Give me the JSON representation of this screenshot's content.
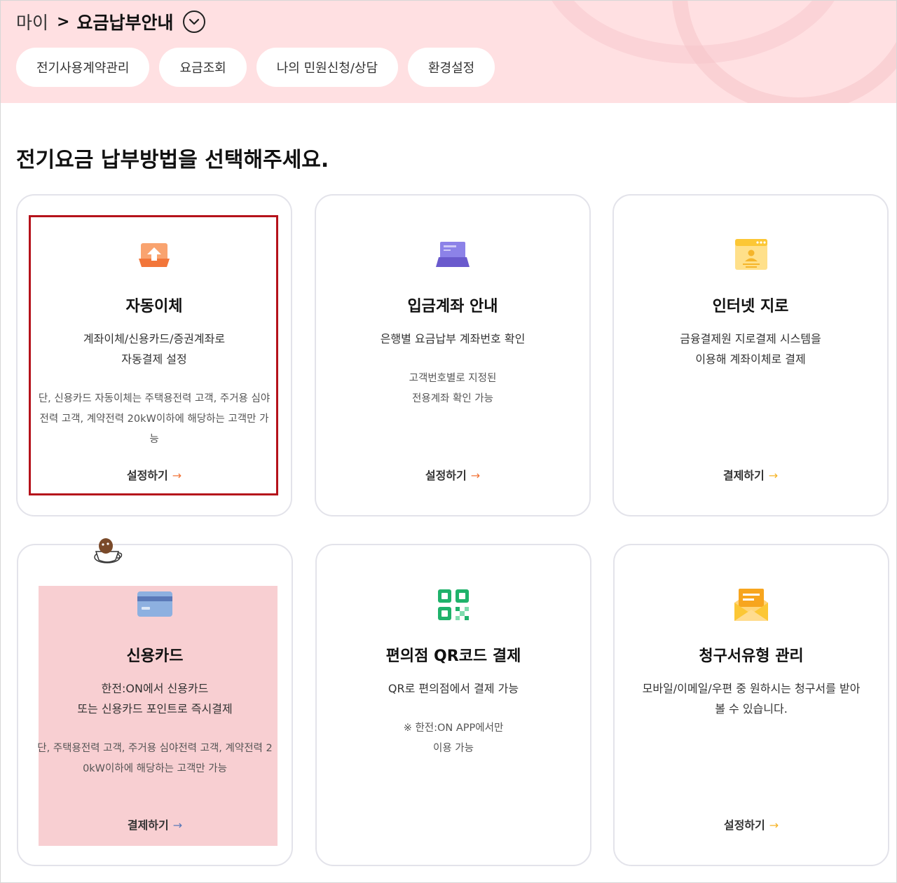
{
  "breadcrumb": {
    "home": "마이",
    "separator": ">",
    "current": "요금납부안내"
  },
  "tabs": [
    {
      "label": "전기사용계약관리"
    },
    {
      "label": "요금조회"
    },
    {
      "label": "나의 민원신청/상담"
    },
    {
      "label": "환경설정"
    }
  ],
  "page_title": "전기요금 납부방법을 선택해주세요.",
  "cards": [
    {
      "title": "자동이체",
      "desc": [
        "계좌이체/신용카드/증권계좌로",
        "자동결제 설정"
      ],
      "note": [
        "단, 신용카드 자동이체는 주택용전력 고객, 주거용 심야",
        "전력 고객, 계약전력 20kW이하에 해당하는 고객만 가",
        "능"
      ],
      "action": "설정하기",
      "icon": "upload-icon"
    },
    {
      "title": "입금계좌 안내",
      "desc": [
        "은행별 요금납부 계좌번호 확인"
      ],
      "note": [
        "고객번호별로 지정된",
        "전용계좌 확인 가능"
      ],
      "action": "설정하기",
      "icon": "laptop-icon"
    },
    {
      "title": "인터넷 지로",
      "desc": [
        "금융결제원 지로결제 시스템을",
        "이용해 계좌이체로 결제"
      ],
      "note": [],
      "action": "결제하기",
      "icon": "web-profile-icon"
    },
    {
      "title": "신용카드",
      "desc": [
        "한전:ON에서 신용카드",
        "또는 신용카드 포인트로 즉시결제"
      ],
      "note": [
        "단, 주택용전력 고객, 주거용 심야전력 고객, 계약전력 2",
        "0kW이하에 해당하는 고객만 가능"
      ],
      "action": "결제하기",
      "icon": "credit-card-icon"
    },
    {
      "title": "편의점 QR코드 결제",
      "desc": [
        "QR로 편의점에서 결제 가능"
      ],
      "note": [
        "※ 한전:ON APP에서만",
        "이용 가능"
      ],
      "action": "",
      "icon": "qr-code-icon"
    },
    {
      "title": "청구서유형 관리",
      "desc": [
        "모바일/이메일/우편 중 원하시는 청구서를 받아",
        "볼 수 있습니다."
      ],
      "note": [],
      "action": "설정하기",
      "icon": "envelope-icon"
    }
  ],
  "colors": {
    "header_bg": "#ffe0e2",
    "accent_orange": "#f2763a",
    "accent_purple": "#6a5acd",
    "accent_yellow": "#fcc735",
    "accent_blue": "#6f8fcb",
    "accent_green": "#1fb26b",
    "highlight_red": "#b5121b"
  }
}
